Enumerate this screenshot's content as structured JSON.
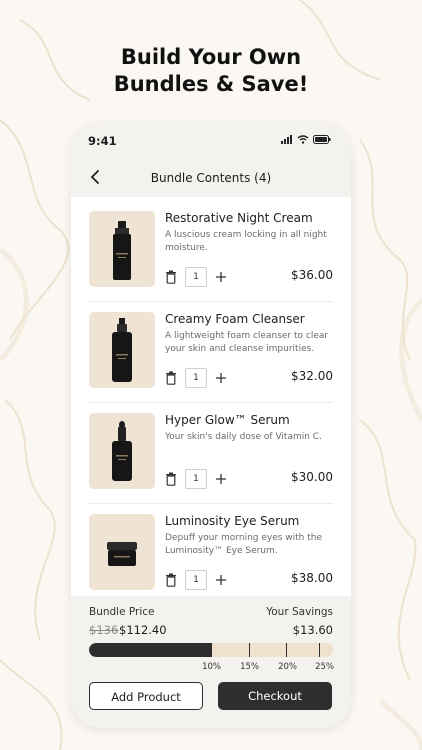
{
  "headline": {
    "line1": "Build Your Own",
    "line2": "Bundles & Save!"
  },
  "status_bar": {
    "time": "9:41"
  },
  "nav": {
    "title": "Bundle Contents (4)"
  },
  "items": [
    {
      "name": "Restorative Night Cream",
      "description": "A luscious cream locking in all night moisture.",
      "quantity": "1",
      "price": "$36.00",
      "product_icon": "dropper-bottle-icon"
    },
    {
      "name": "Creamy Foam Cleanser",
      "description": "A lightweight foam cleanser to clear your skin and cleanse impurities.",
      "quantity": "1",
      "price": "$32.00",
      "product_icon": "pump-bottle-icon"
    },
    {
      "name": "Hyper Glow™ Serum",
      "description": "Your skin's daily dose of Vitamin C.",
      "quantity": "1",
      "price": "$30.00",
      "product_icon": "serum-dropper-icon"
    },
    {
      "name": "Luminosity Eye Serum",
      "description": "Depuff your morning eyes with the Luminosity™ Eye Serum.",
      "quantity": "1",
      "price": "$38.00",
      "product_icon": "cream-jar-icon"
    }
  ],
  "footer": {
    "bundle_price_label": "Bundle Price",
    "savings_label": "Your Savings",
    "original_price": "$136",
    "bundle_price": "$112.40",
    "savings_value": "$13.60",
    "progress_fraction": 0.5,
    "tiers": [
      "10%",
      "15%",
      "20%",
      "25%"
    ],
    "add_product_label": "Add Product",
    "checkout_label": "Checkout"
  },
  "colors": {
    "background": "#fbf8f3",
    "thumb_bg": "#efe3d3",
    "progress_fill": "#2e2e2e",
    "progress_track": "#efe1cd",
    "checkout_bg": "#2e2e2e"
  }
}
